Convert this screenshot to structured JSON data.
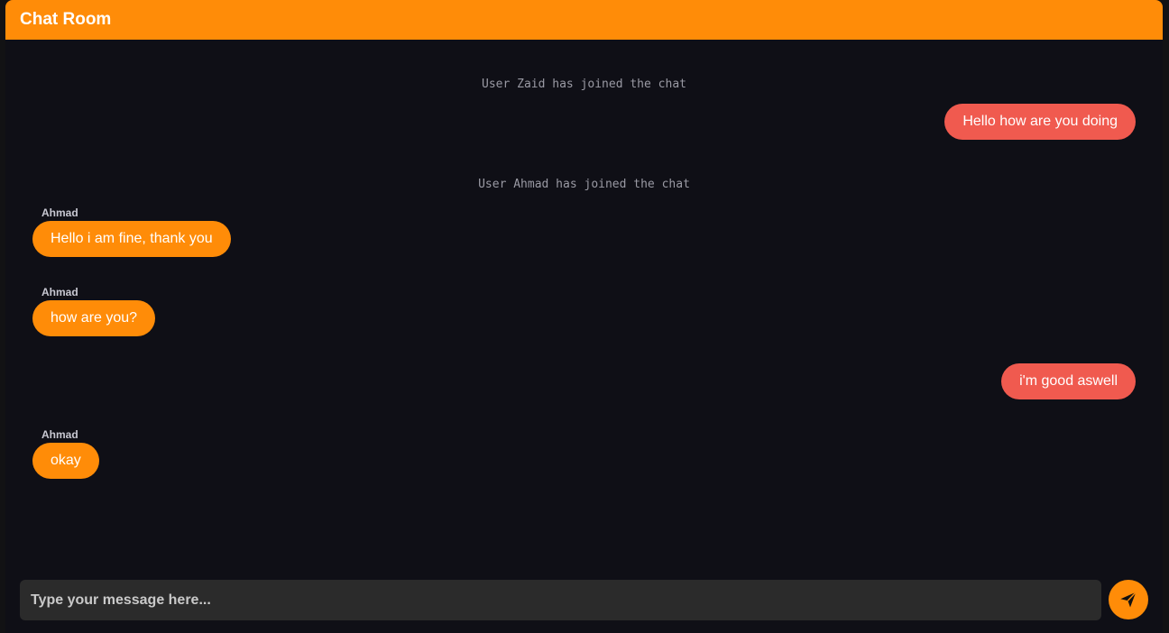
{
  "header": {
    "title": "Chat Room"
  },
  "messages": [
    {
      "type": "system",
      "text": "User Zaid has joined the chat"
    },
    {
      "type": "outgoing",
      "text": "Hello how are you doing"
    },
    {
      "type": "system",
      "text": "User Ahmad has joined the chat"
    },
    {
      "type": "incoming",
      "sender": "Ahmad",
      "text": "Hello i am fine, thank you"
    },
    {
      "type": "incoming",
      "sender": "Ahmad",
      "text": "how are you?"
    },
    {
      "type": "outgoing",
      "text": "i'm good aswell"
    },
    {
      "type": "incoming",
      "sender": "Ahmad",
      "text": "okay"
    }
  ],
  "composer": {
    "placeholder": "Type your message here...",
    "value": ""
  },
  "send_button": {
    "icon": "send-icon"
  },
  "colors": {
    "accent": "#ff8c08",
    "outgoing_bubble": "#f05a4f",
    "background": "#0f0f16",
    "input_bg": "#2b2b2b"
  }
}
